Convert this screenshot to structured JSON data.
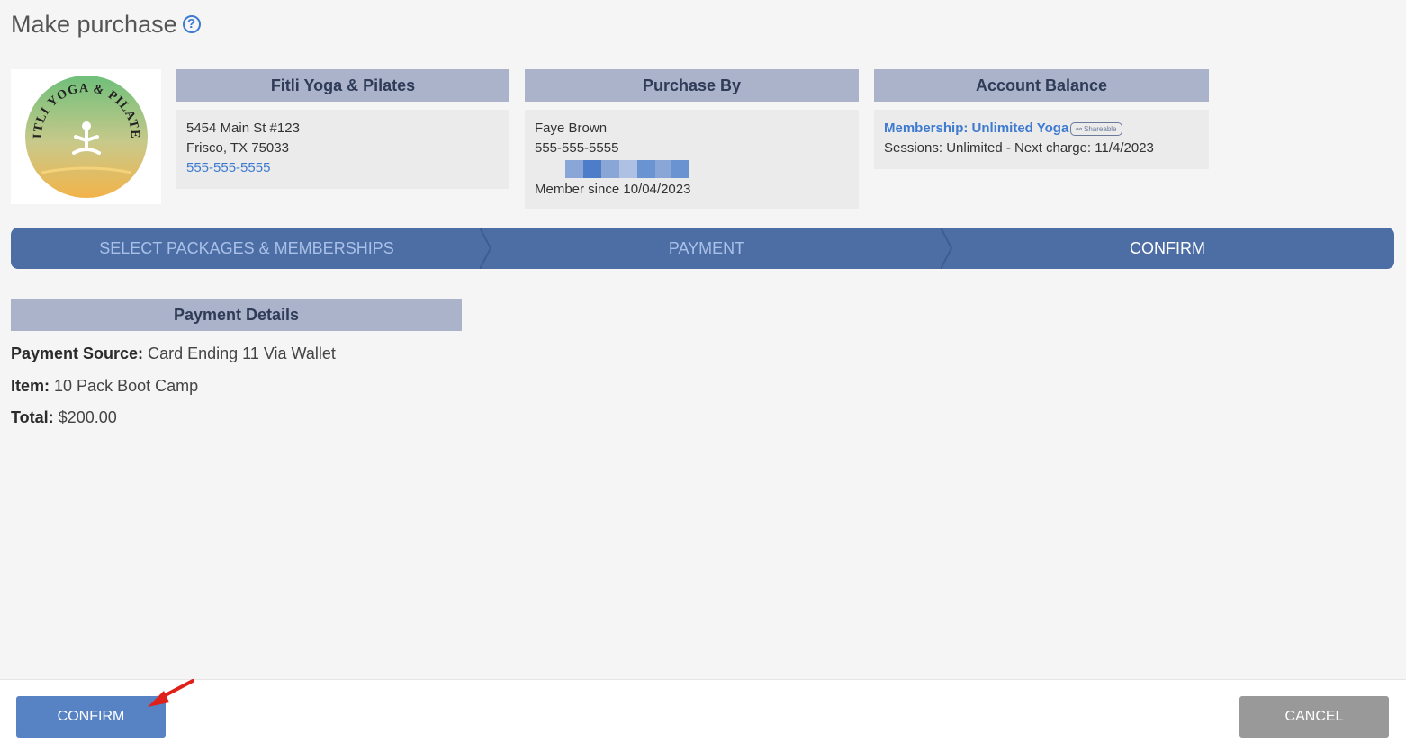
{
  "page": {
    "title": "Make purchase",
    "help_icon": "question-circle-icon"
  },
  "logo": {
    "alt": "Fitli Yoga & Pilates logo",
    "text": "FITLI YOGA & PILATES"
  },
  "studio": {
    "header": "Fitli Yoga & Pilates",
    "address_line1": "5454 Main St #123",
    "address_line2": "Frisco, TX 75033",
    "phone": "555-555-5555"
  },
  "purchaser": {
    "header": "Purchase By",
    "name": "Faye Brown",
    "phone": "555-555-5555",
    "member_since": "Member since 10/04/2023"
  },
  "account": {
    "header": "Account Balance",
    "membership": "Membership: Unlimited Yoga",
    "badge": "Shareable",
    "sessions": "Sessions: Unlimited -  Next charge: 11/4/2023"
  },
  "steps": [
    {
      "label": "SELECT PACKAGES & MEMBERSHIPS",
      "active": false
    },
    {
      "label": "PAYMENT",
      "active": false
    },
    {
      "label": "CONFIRM",
      "active": true
    }
  ],
  "payment_details": {
    "header": "Payment Details",
    "source_label": "Payment Source:",
    "source_value": "Card Ending 11 Via Wallet",
    "item_label": "Item:",
    "item_value": "10 Pack Boot Camp",
    "total_label": "Total:",
    "total_value": "$200.00"
  },
  "footer": {
    "confirm_label": "CONFIRM",
    "cancel_label": "CANCEL"
  },
  "colors": {
    "accent": "#3e7bd0",
    "stepper": "#4d6ea5",
    "header_bar": "#aab3c9",
    "confirm_button": "#5783c4",
    "cancel_button": "#999999",
    "annotation_arrow": "#e0201b"
  }
}
